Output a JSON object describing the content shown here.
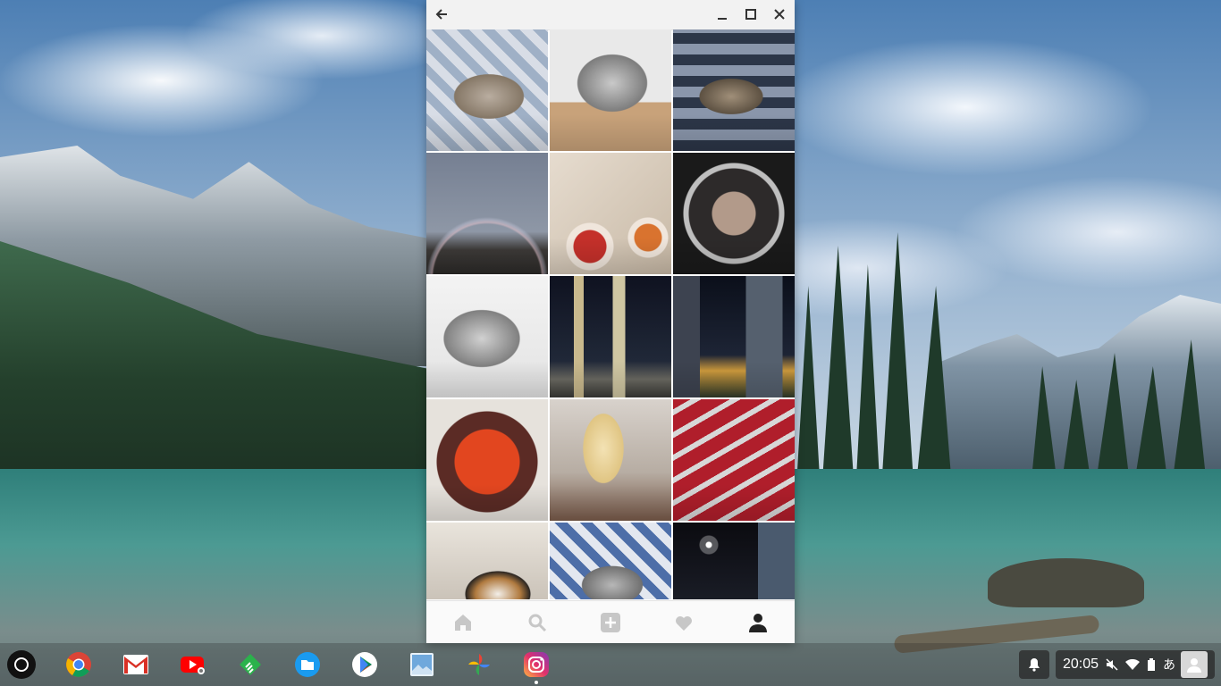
{
  "window": {
    "controls": [
      "back-icon",
      "minimize-icon",
      "maximize-icon",
      "close-icon"
    ]
  },
  "feed": {
    "tiles": [
      {
        "subject": "cat-sleeping-on-plaid",
        "id": 1
      },
      {
        "subject": "cat-sleeping-on-table",
        "id": 2
      },
      {
        "subject": "cat-on-blanket",
        "id": 3
      },
      {
        "subject": "rainbow-over-street",
        "id": 4
      },
      {
        "subject": "korean-bbq-dishes",
        "id": 5
      },
      {
        "subject": "food-in-pot",
        "id": 6
      },
      {
        "subject": "cat-close-up",
        "id": 7
      },
      {
        "subject": "city-night-towers",
        "id": 8
      },
      {
        "subject": "city-night-street",
        "id": 9
      },
      {
        "subject": "salmon-roe-bowl",
        "id": 10
      },
      {
        "subject": "soft-serve-cone",
        "id": 11
      },
      {
        "subject": "red-tins",
        "id": 12
      },
      {
        "subject": "calico-cat",
        "id": 13
      },
      {
        "subject": "cat-on-blue-blanket",
        "id": 14
      },
      {
        "subject": "city-night-building",
        "id": 15
      }
    ]
  },
  "bottom_nav": {
    "items": [
      "home-icon",
      "search-icon",
      "add-post-icon",
      "heart-icon",
      "profile-icon"
    ],
    "active": "profile-icon"
  },
  "shelf": {
    "apps": [
      "chrome",
      "gmail",
      "youtube",
      "feedly",
      "files",
      "play-store",
      "photos-viewer",
      "google-photos",
      "instagram"
    ]
  },
  "tray": {
    "time": "20:05",
    "ime": "あ",
    "icons": [
      "notification-icon",
      "mute-icon",
      "wifi-icon",
      "battery-icon",
      "user-avatar-icon"
    ]
  },
  "colors": {
    "instagram_gradient": "#d6249f",
    "shelf_bg": "#1e1e1e",
    "tray_bg": "#282828"
  }
}
